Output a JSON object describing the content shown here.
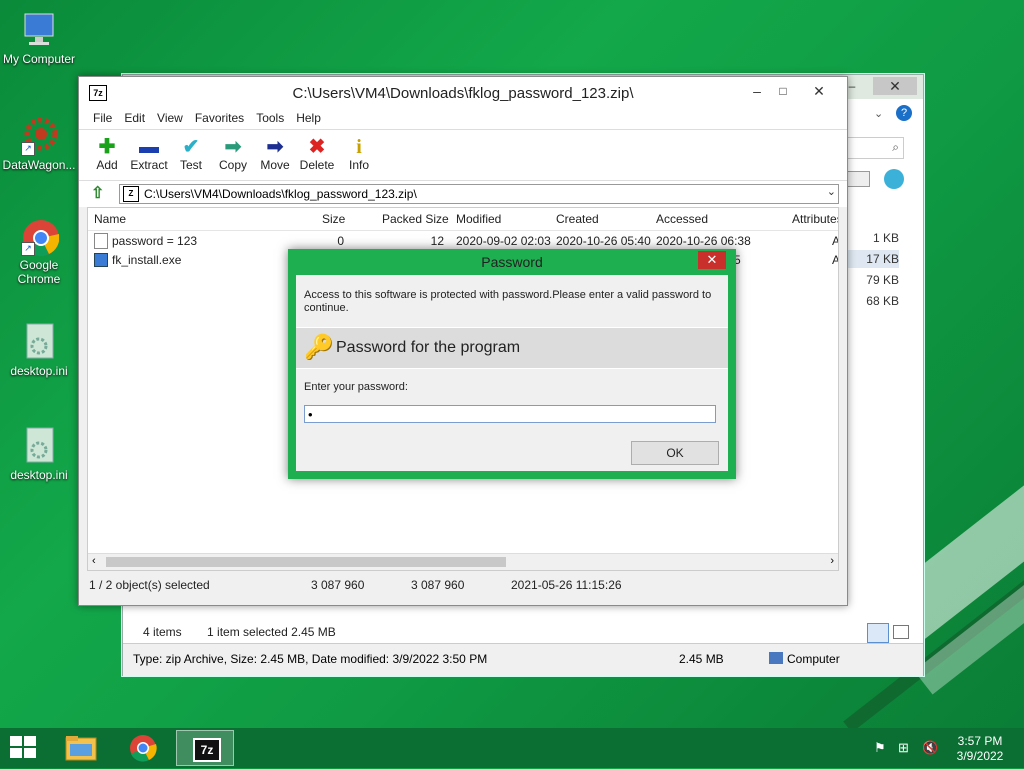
{
  "desktop": {
    "icons": [
      {
        "label": "My Computer"
      },
      {
        "label": "DataWagon..."
      },
      {
        "label": "Google Chrome"
      },
      {
        "label": "desktop.ini"
      },
      {
        "label": "desktop.ini"
      }
    ]
  },
  "explorer": {
    "sizes": [
      "1 KB",
      "17 KB",
      "79 KB",
      "68 KB"
    ],
    "status_items": "4 items",
    "status_selected": "1 item selected  2.45 MB",
    "details": "Type: zip Archive, Size: 2.45 MB, Date modified: 3/9/2022 3:50 PM",
    "details_size": "2.45 MB",
    "details_location": "Computer"
  },
  "window7z": {
    "title": "C:\\Users\\VM4\\Downloads\\fklog_password_123.zip\\",
    "menu": [
      "File",
      "Edit",
      "View",
      "Favorites",
      "Tools",
      "Help"
    ],
    "toolbar": [
      {
        "label": "Add",
        "icon": "plus-icon"
      },
      {
        "label": "Extract",
        "icon": "minus-icon"
      },
      {
        "label": "Test",
        "icon": "check-icon"
      },
      {
        "label": "Copy",
        "icon": "copy-arrow-icon"
      },
      {
        "label": "Move",
        "icon": "move-arrow-icon"
      },
      {
        "label": "Delete",
        "icon": "x-icon"
      },
      {
        "label": "Info",
        "icon": "info-icon"
      }
    ],
    "address": "C:\\Users\\VM4\\Downloads\\fklog_password_123.zip\\",
    "columns": [
      "Name",
      "Size",
      "Packed Size",
      "Modified",
      "Created",
      "Accessed",
      "Attributes"
    ],
    "rows": [
      {
        "name": "password = 123",
        "size": "0",
        "packed": "12",
        "modified": "2020-09-02 02:03",
        "created": "2020-10-26 05:40",
        "accessed": "2020-10-26 06:38",
        "attr": "A"
      },
      {
        "name": "fk_install.exe",
        "size": "",
        "packed": "",
        "modified": "",
        "created": "",
        "accessed": "5",
        "attr": "A"
      }
    ],
    "status": {
      "selected": "1 / 2 object(s) selected",
      "size": "3 087 960",
      "packed": "3 087 960",
      "date": "2021-05-26 11:15:26"
    }
  },
  "password_dialog": {
    "title": "Password",
    "message": "Access to this software is protected with password.Please enter a valid password to continue.",
    "header": "Password for the program",
    "label": "Enter your password:",
    "value": "•",
    "ok_label": "OK"
  },
  "taskbar": {
    "time": "3:57 PM",
    "date": "3/9/2022",
    "apps": [
      "file-explorer",
      "google-chrome",
      "7-zip"
    ]
  }
}
